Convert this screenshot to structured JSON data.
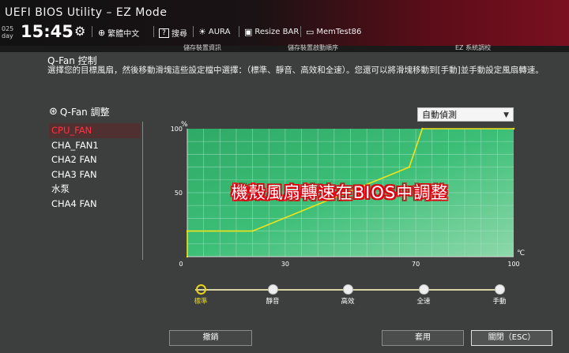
{
  "header": {
    "title": "UEFI BIOS Utility – EZ Mode",
    "date_line1": "025",
    "date_line2": "day",
    "time": "15:45",
    "settings_icon": "gear-icon",
    "tools": [
      {
        "label": "繁體中文",
        "icon": "globe-icon",
        "glyph": "⊕"
      },
      {
        "label": "搜尋",
        "icon": "help-icon",
        "glyph": "?"
      },
      {
        "label": "AURA",
        "icon": "aura-icon",
        "glyph": "☀"
      },
      {
        "label": "Resize BAR",
        "icon": "resize-bar-icon",
        "glyph": "▣"
      },
      {
        "label": "MemTest86",
        "icon": "memtest-icon",
        "glyph": "▭"
      }
    ]
  },
  "tabstrip": {
    "left": "儲存裝置資訊",
    "middle": "儲存裝置啟動順序",
    "right": "EZ 系統調校"
  },
  "qfan": {
    "title": "Q-Fan 控制",
    "description": "選擇您的目標風扇，然後移動滑塊這些設定檔中選擇：（標準、靜音、高效和全速）。您還可以將滑塊移動到[手動]並手動設定風扇轉速。",
    "list_title": "Q-Fan 調整",
    "fans": [
      "CPU_FAN",
      "CHA_FAN1",
      "CHA2 FAN",
      "CHA3 FAN",
      "水泵",
      "CHA4 FAN"
    ],
    "selected_fan": "CPU_FAN",
    "mode": "自動偵測"
  },
  "overlay_caption": "機殼風扇轉速在BIOS中調整",
  "chart_data": {
    "type": "line",
    "x_unit": "℃",
    "y_unit": "%",
    "xlim": [
      0,
      100
    ],
    "ylim": [
      0,
      100
    ],
    "x_ticks": [
      0,
      30,
      70,
      100
    ],
    "y_ticks": [
      50,
      100
    ],
    "grid": true,
    "series": [
      {
        "x": [
          0,
          0,
          20,
          68,
          72,
          100
        ],
        "y": [
          0,
          20,
          20,
          70,
          100,
          100
        ]
      }
    ],
    "colors": {
      "fill": "#3fbf7a",
      "line": "#f2e21a",
      "grid": "#9fe0bf"
    }
  },
  "presets": {
    "items": [
      "標準",
      "靜音",
      "高效",
      "全速",
      "手動"
    ],
    "selected_index": 0
  },
  "buttons": {
    "undo": "撤銷",
    "apply": "套用",
    "close": "關閉（ESC）"
  }
}
